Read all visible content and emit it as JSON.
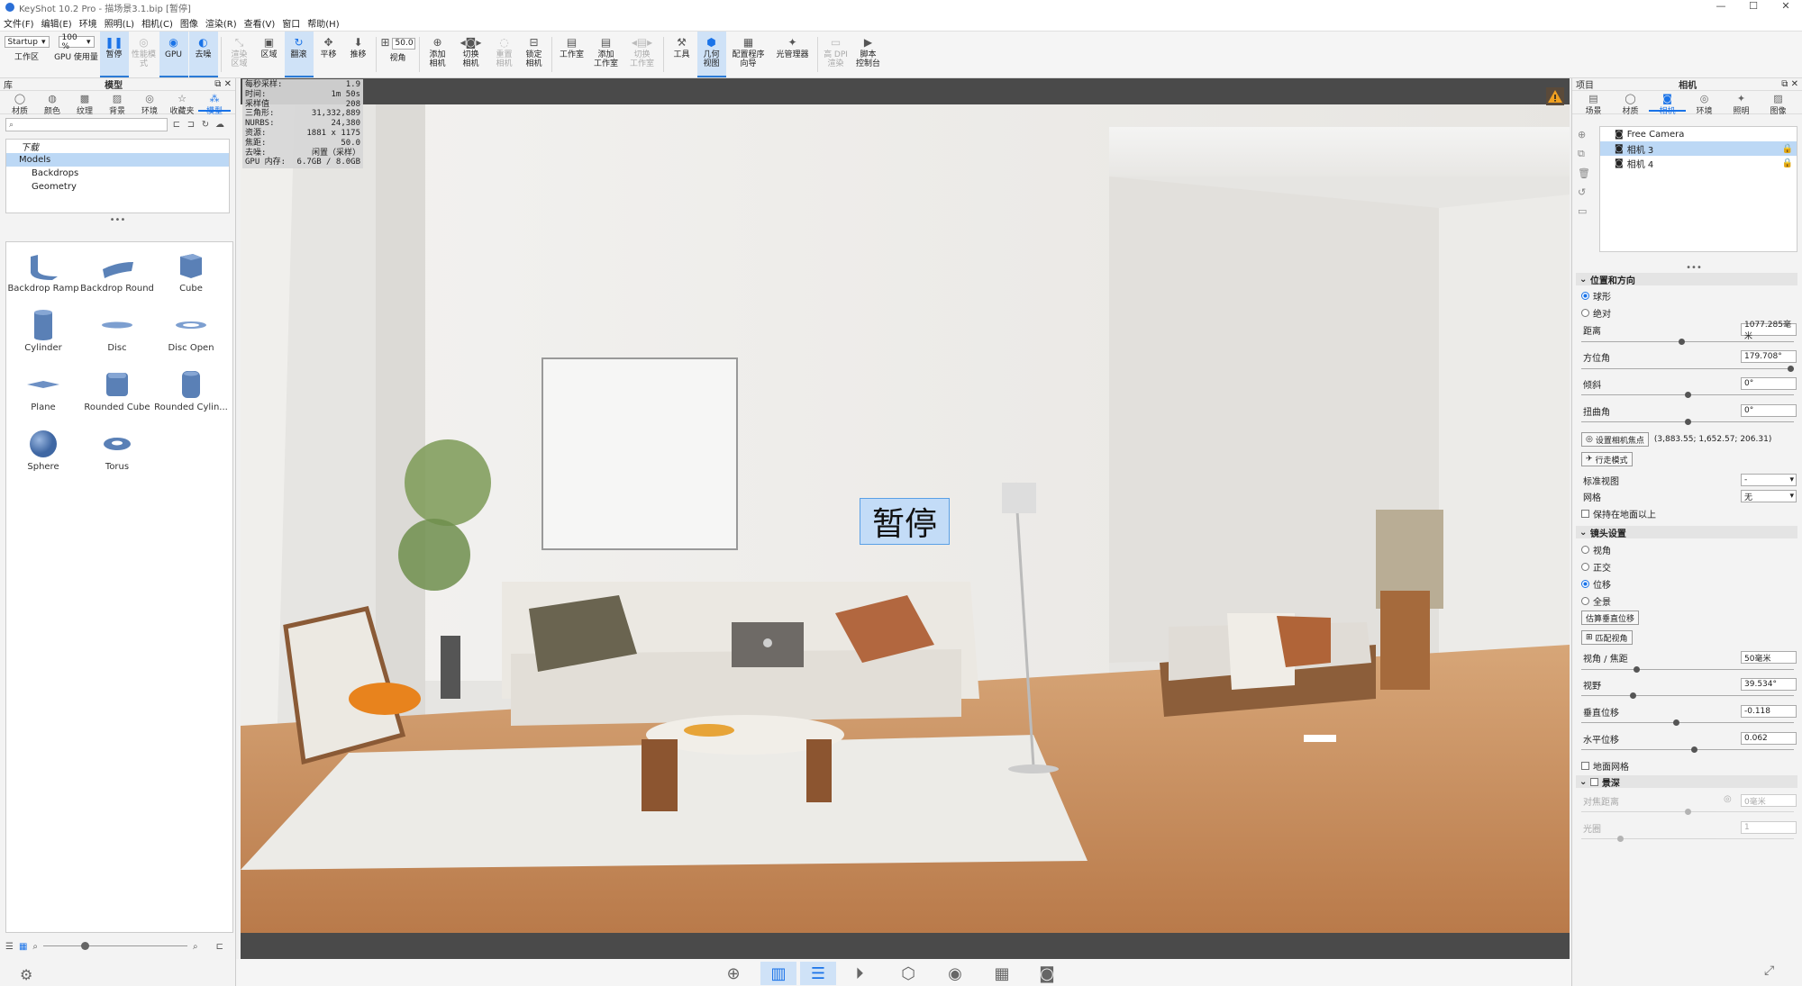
{
  "window": {
    "title": "KeyShot 10.2 Pro - 描场景3.1.bip [暂停]",
    "min": "—",
    "max": "☐",
    "close": "✕"
  },
  "menu": [
    "文件(F)",
    "编辑(E)",
    "环境",
    "照明(L)",
    "相机(C)",
    "图像",
    "渲染(R)",
    "查看(V)",
    "窗口",
    "帮助(H)"
  ],
  "toolbar": {
    "workspace_select": "Startup",
    "workspace_label": "工作区",
    "gpu_select": "100 %",
    "gpu_label": "GPU 使用量",
    "pause": "暂停",
    "perf": "性能模式",
    "gpu": "GPU",
    "denoise": "去噪",
    "render_region_a": "渲染",
    "render_region_b": "区域",
    "region": "区域",
    "flip": "翻滚",
    "pan": "平移",
    "dolly": "推移",
    "fov_value": "50.0",
    "fov": "视角",
    "add_cam_a": "添加",
    "add_cam_b": "相机",
    "switch_cam_a": "切换",
    "switch_cam_b": "相机",
    "reset_cam_a": "重置",
    "reset_cam_b": "相机",
    "lock_cam_a": "锁定",
    "lock_cam_b": "相机",
    "studio": "工作室",
    "add_studio_a": "添加",
    "add_studio_b": "工作室",
    "switch_studio_a": "切换",
    "switch_studio_b": "工作室",
    "tools": "工具",
    "geo_view_a": "几何",
    "geo_view_b": "视图",
    "config_a": "配置程序",
    "config_b": "向导",
    "light_mgr": "光管理器",
    "hidpi_a": "高 DPI",
    "hidpi_b": "渲染",
    "script_a": "脚本",
    "script_b": "控制台"
  },
  "left": {
    "panel_title": "库",
    "panel_sub": "模型",
    "tabs": [
      "材质",
      "颜色",
      "纹理",
      "背景",
      "环境",
      "收藏夹",
      "模型"
    ],
    "search_placeholder": "",
    "tree": [
      "下载",
      "Models",
      "Backdrops",
      "Geometry"
    ],
    "models": [
      "Backdrop Ramp",
      "Backdrop Round",
      "Cube",
      "Cylinder",
      "Disc",
      "Disc Open",
      "Plane",
      "Rounded Cube",
      "Rounded Cylin...",
      "Sphere",
      "Torus"
    ]
  },
  "stats": [
    [
      "每秒采样:",
      "1.9"
    ],
    [
      "时间:",
      "1m 50s"
    ],
    [
      "采样值",
      "208"
    ],
    [
      "三角形:",
      "31,332,889"
    ],
    [
      "NURBS:",
      "24,380"
    ],
    [
      "资源:",
      "1881 x 1175"
    ],
    [
      "焦距:",
      "50.0"
    ],
    [
      "去噪:",
      "闲置（采样）"
    ],
    [
      "GPU 内存:",
      "6.7GB / 8.0GB"
    ]
  ],
  "viewport": {
    "pause_overlay": "暂停"
  },
  "right": {
    "panel_title": "项目",
    "panel_sub": "相机",
    "tabs": [
      "场景",
      "材质",
      "相机",
      "环境",
      "照明",
      "图像"
    ],
    "cameras": [
      "Free Camera",
      "相机 3",
      "相机 4"
    ],
    "sec_position": "位置和方向",
    "spherical": "球形",
    "absolute": "绝对",
    "distance": "距离",
    "distance_val": "1077.285毫米",
    "azimuth": "方位角",
    "azimuth_val": "179.708°",
    "incline": "倾斜",
    "incline_val": "0°",
    "twist": "扭曲角",
    "twist_val": "0°",
    "set_focus": "设置相机焦点",
    "focus_coords": "(3,883.55; 1,652.57; 206.31)",
    "walk": "行走模式",
    "std_view": "标准视图",
    "std_view_val": "-",
    "grid": "网格",
    "grid_val": "无",
    "keep_above": "保持在地面以上",
    "sec_lens": "镜头设置",
    "lens_fov": "视角",
    "lens_ortho": "正交",
    "lens_shift": "位移",
    "lens_pano": "全景",
    "estimate": "估算垂直位移",
    "match": "匹配视角",
    "fov_focal": "视角 / 焦距",
    "fov_focal_val": "50毫米",
    "field": "视野",
    "field_val": "39.534°",
    "vshift": "垂直位移",
    "vshift_val": "-0.118",
    "hshift": "水平位移",
    "hshift_val": "0.062",
    "ground_grid": "地面网格",
    "sec_dof": "景深",
    "focus_dist": "对焦距离",
    "focus_dist_val": "0毫米",
    "aperture": "光圈",
    "aperture_val": "1"
  }
}
